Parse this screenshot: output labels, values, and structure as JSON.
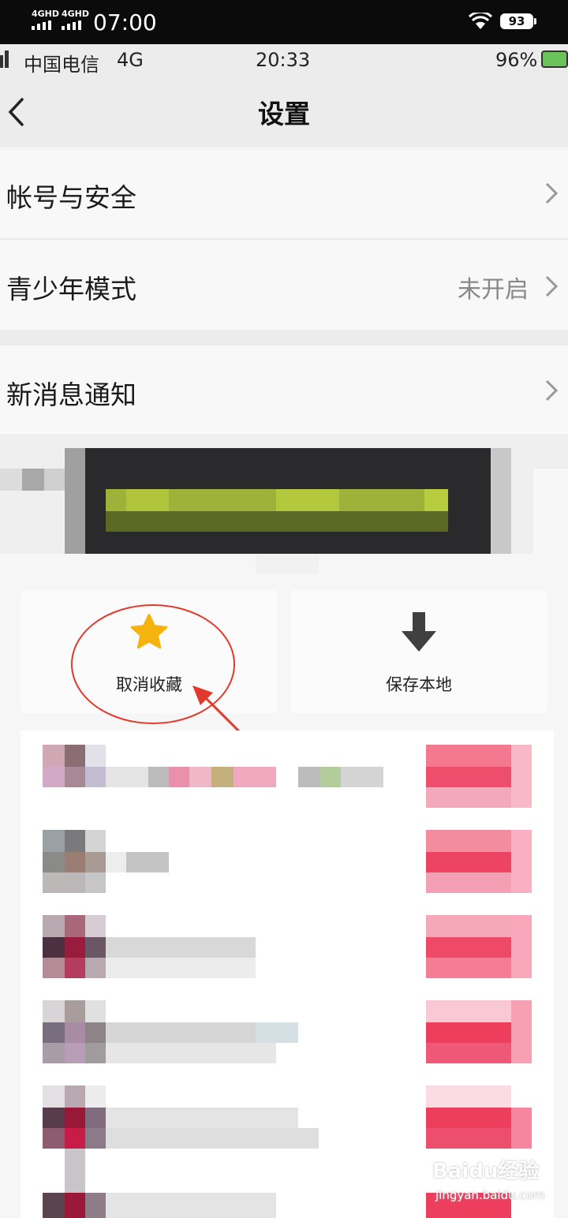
{
  "outer_status": {
    "network1": "4GHD",
    "network2": "4GHD",
    "time": "07:00",
    "battery": "93"
  },
  "inner_status": {
    "carrier": "中国电信",
    "network": "4G",
    "time": "20:33",
    "battery": "96%"
  },
  "nav": {
    "title": "设置",
    "back_icon": "chevron-left-icon"
  },
  "settings": {
    "account": "帐号与安全",
    "teen_mode": "青少年模式",
    "teen_mode_value": "未开启",
    "notifications": "新消息通知"
  },
  "sheet": {
    "unfavorite": "取消收藏",
    "save_local": "保存本地",
    "star_icon": "star-icon",
    "download_icon": "download-arrow-icon"
  },
  "colors": {
    "star": "#f5b30f",
    "annotation": "#e23a2a"
  },
  "watermark": {
    "brand": "Baidu经验",
    "url": "jingyan.baidu.com"
  }
}
